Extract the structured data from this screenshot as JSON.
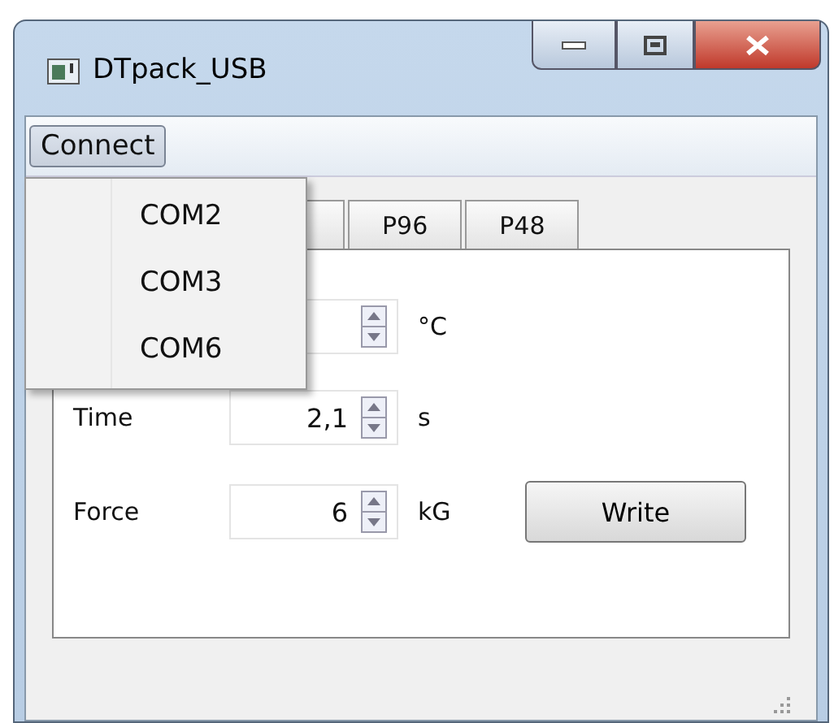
{
  "window": {
    "title": "DTpack_USB"
  },
  "menu": {
    "label": "Connect",
    "open": true,
    "items": [
      {
        "label": "COM2"
      },
      {
        "label": "COM3"
      },
      {
        "label": "COM6"
      }
    ]
  },
  "tabs": [
    {
      "label": "P96",
      "selected": false
    },
    {
      "label": "P48",
      "selected": false
    }
  ],
  "fields": [
    {
      "unit": "°C"
    },
    {
      "label": "Time",
      "value": "2,1",
      "unit": "s"
    },
    {
      "label": "Force",
      "value": "6",
      "unit": "kG"
    }
  ],
  "buttons": [
    "Write"
  ]
}
